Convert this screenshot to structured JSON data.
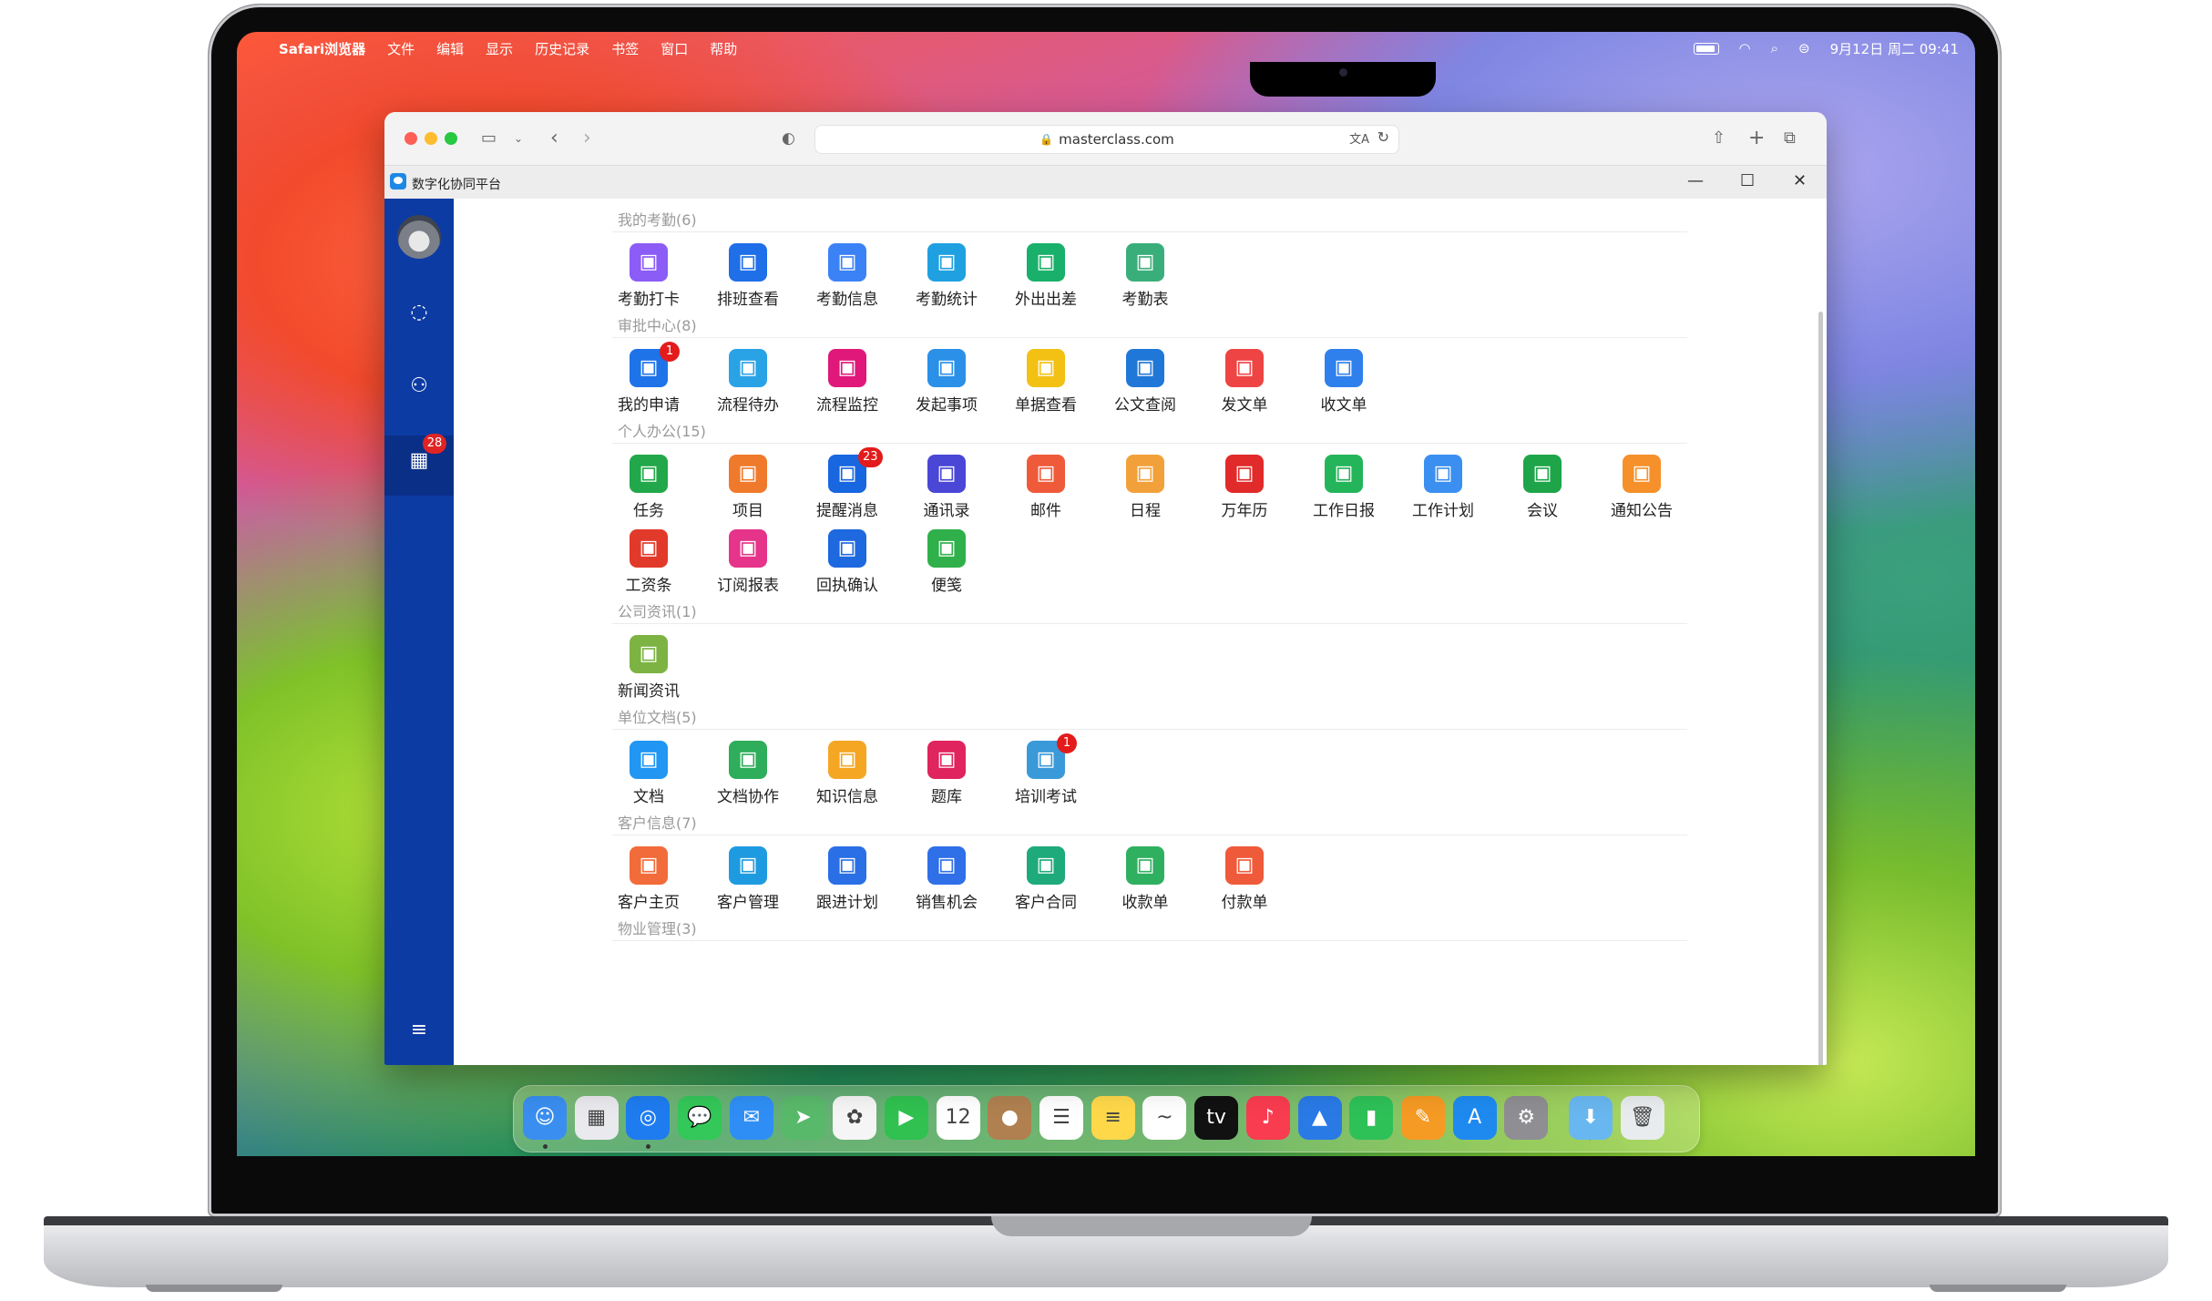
{
  "menubar": {
    "app": "Safari浏览器",
    "items": [
      "文件",
      "编辑",
      "显示",
      "历史记录",
      "书签",
      "窗口",
      "帮助"
    ],
    "datetime": "9月12日 周二 09:41"
  },
  "browser": {
    "url": "masterclass.com"
  },
  "app": {
    "title": "数字化协同平台",
    "sidebar_badge": "28"
  },
  "sections": [
    {
      "title": "我的考勤(6)",
      "items": [
        {
          "label": "考勤打卡",
          "color": "#8b5cf6",
          "icon": "location-pin-icon"
        },
        {
          "label": "排班查看",
          "color": "#1e6fe8",
          "icon": "schedule-icon"
        },
        {
          "label": "考勤信息",
          "color": "#3b82f6",
          "icon": "calendar-check-icon"
        },
        {
          "label": "考勤统计",
          "color": "#1fa0e0",
          "icon": "stats-icon"
        },
        {
          "label": "外出出差",
          "color": "#18b06a",
          "icon": "plane-icon"
        },
        {
          "label": "考勤表",
          "color": "#3aae7a",
          "icon": "sheet-check-icon"
        }
      ]
    },
    {
      "title": "审批中心(8)",
      "items": [
        {
          "label": "我的申请",
          "color": "#1e73e8",
          "icon": "apply-icon",
          "badge": "1"
        },
        {
          "label": "流程待办",
          "color": "#2aa2e6",
          "icon": "todo-icon"
        },
        {
          "label": "流程监控",
          "color": "#e0187a",
          "icon": "monitor-icon"
        },
        {
          "label": "发起事项",
          "color": "#2a90e8",
          "icon": "send-item-icon"
        },
        {
          "label": "单据查看",
          "color": "#f2c114",
          "icon": "receipt-icon"
        },
        {
          "label": "公文查阅",
          "color": "#1f78d8",
          "icon": "excel-doc-icon"
        },
        {
          "label": "发文单",
          "color": "#ef4444",
          "icon": "send-mail-icon"
        },
        {
          "label": "收文单",
          "color": "#2f80ed",
          "icon": "receive-mail-icon"
        }
      ]
    },
    {
      "title": "个人办公(15)",
      "items": [
        {
          "label": "任务",
          "color": "#22a84a",
          "icon": "task-check-icon"
        },
        {
          "label": "项目",
          "color": "#f07a2b",
          "icon": "project-icon"
        },
        {
          "label": "提醒消息",
          "color": "#1866e0",
          "icon": "alert-icon",
          "badge": "23"
        },
        {
          "label": "通讯录",
          "color": "#4a46d6",
          "icon": "contacts-icon"
        },
        {
          "label": "邮件",
          "color": "#ef5a3a",
          "icon": "mail-icon"
        },
        {
          "label": "日程",
          "color": "#f2a13a",
          "icon": "agenda-icon"
        },
        {
          "label": "万年历",
          "color": "#e12a2a",
          "icon": "calendar-icon"
        },
        {
          "label": "工作日报",
          "color": "#24b55a",
          "icon": "daily-report-icon"
        },
        {
          "label": "工作计划",
          "color": "#3b8ff0",
          "icon": "edit-plan-icon"
        },
        {
          "label": "会议",
          "color": "#1ea54a",
          "icon": "meeting-icon"
        },
        {
          "label": "通知公告",
          "color": "#f5902a",
          "icon": "megaphone-icon"
        },
        {
          "label": "工资条",
          "color": "#e23a2a",
          "icon": "salary-icon"
        },
        {
          "label": "订阅报表",
          "color": "#e5348a",
          "icon": "subscribe-report-icon"
        },
        {
          "label": "回执确认",
          "color": "#1e68e0",
          "icon": "receipt-confirm-icon"
        },
        {
          "label": "便笺",
          "color": "#2fb04a",
          "icon": "note-icon"
        }
      ]
    },
    {
      "title": "公司资讯(1)",
      "items": [
        {
          "label": "新闻资讯",
          "color": "#7cb342",
          "icon": "news-icon"
        }
      ]
    },
    {
      "title": "单位文档(5)",
      "items": [
        {
          "label": "文档",
          "color": "#2196f3",
          "icon": "folder-icon"
        },
        {
          "label": "文档协作",
          "color": "#2eae5a",
          "icon": "doc-collab-icon"
        },
        {
          "label": "知识信息",
          "color": "#f5a623",
          "icon": "book-icon"
        },
        {
          "label": "题库",
          "color": "#e0245e",
          "icon": "question-bank-icon"
        },
        {
          "label": "培训考试",
          "color": "#3a9ad9",
          "icon": "exam-icon",
          "badge": "1"
        }
      ]
    },
    {
      "title": "客户信息(7)",
      "items": [
        {
          "label": "客户主页",
          "color": "#f26b3a",
          "icon": "home-icon"
        },
        {
          "label": "客户管理",
          "color": "#1e9be0",
          "icon": "customers-icon"
        },
        {
          "label": "跟进计划",
          "color": "#2a6fe6",
          "icon": "followup-icon"
        },
        {
          "label": "销售机会",
          "color": "#2f6fe8",
          "icon": "opportunity-icon"
        },
        {
          "label": "客户合同",
          "color": "#1eaa7a",
          "icon": "contract-icon"
        },
        {
          "label": "收款单",
          "color": "#2fb060",
          "icon": "receivable-icon"
        },
        {
          "label": "付款单",
          "color": "#ef5a3a",
          "icon": "payment-icon"
        }
      ]
    },
    {
      "title": "物业管理(3)",
      "items": []
    }
  ],
  "dock": [
    {
      "name": "finder",
      "color": "#3a8ef0",
      "glyph": "☺"
    },
    {
      "name": "launchpad",
      "color": "#e9e9ee",
      "glyph": "▦"
    },
    {
      "name": "safari",
      "color": "#1e7cf0",
      "glyph": "◎"
    },
    {
      "name": "messages",
      "color": "#34c759",
      "glyph": "💬"
    },
    {
      "name": "mail",
      "color": "#2f8ef5",
      "glyph": "✉"
    },
    {
      "name": "maps",
      "color": "#59b96a",
      "glyph": "➤"
    },
    {
      "name": "photos",
      "color": "#f5f5f5",
      "glyph": "✿"
    },
    {
      "name": "facetime",
      "color": "#30c150",
      "glyph": "▶"
    },
    {
      "name": "calendar",
      "color": "#ffffff",
      "glyph": "12"
    },
    {
      "name": "contacts",
      "color": "#b08050",
      "glyph": "●"
    },
    {
      "name": "reminders",
      "color": "#ffffff",
      "glyph": "☰"
    },
    {
      "name": "notes",
      "color": "#ffd84a",
      "glyph": "≡"
    },
    {
      "name": "freeform",
      "color": "#ffffff",
      "glyph": "~"
    },
    {
      "name": "appletv",
      "color": "#111111",
      "glyph": "tv"
    },
    {
      "name": "music",
      "color": "#fa3c50",
      "glyph": "♪"
    },
    {
      "name": "keynote",
      "color": "#2a7ae6",
      "glyph": "▲"
    },
    {
      "name": "numbers",
      "color": "#2ec158",
      "glyph": "▮"
    },
    {
      "name": "pages",
      "color": "#f59a23",
      "glyph": "✎"
    },
    {
      "name": "appstore",
      "color": "#1e8af0",
      "glyph": "A"
    },
    {
      "name": "settings",
      "color": "#8e8e93",
      "glyph": "⚙"
    },
    {
      "name": "downloads",
      "color": "#69b7f0",
      "glyph": "⬇"
    },
    {
      "name": "trash",
      "color": "#e9ecef",
      "glyph": "🗑"
    }
  ]
}
